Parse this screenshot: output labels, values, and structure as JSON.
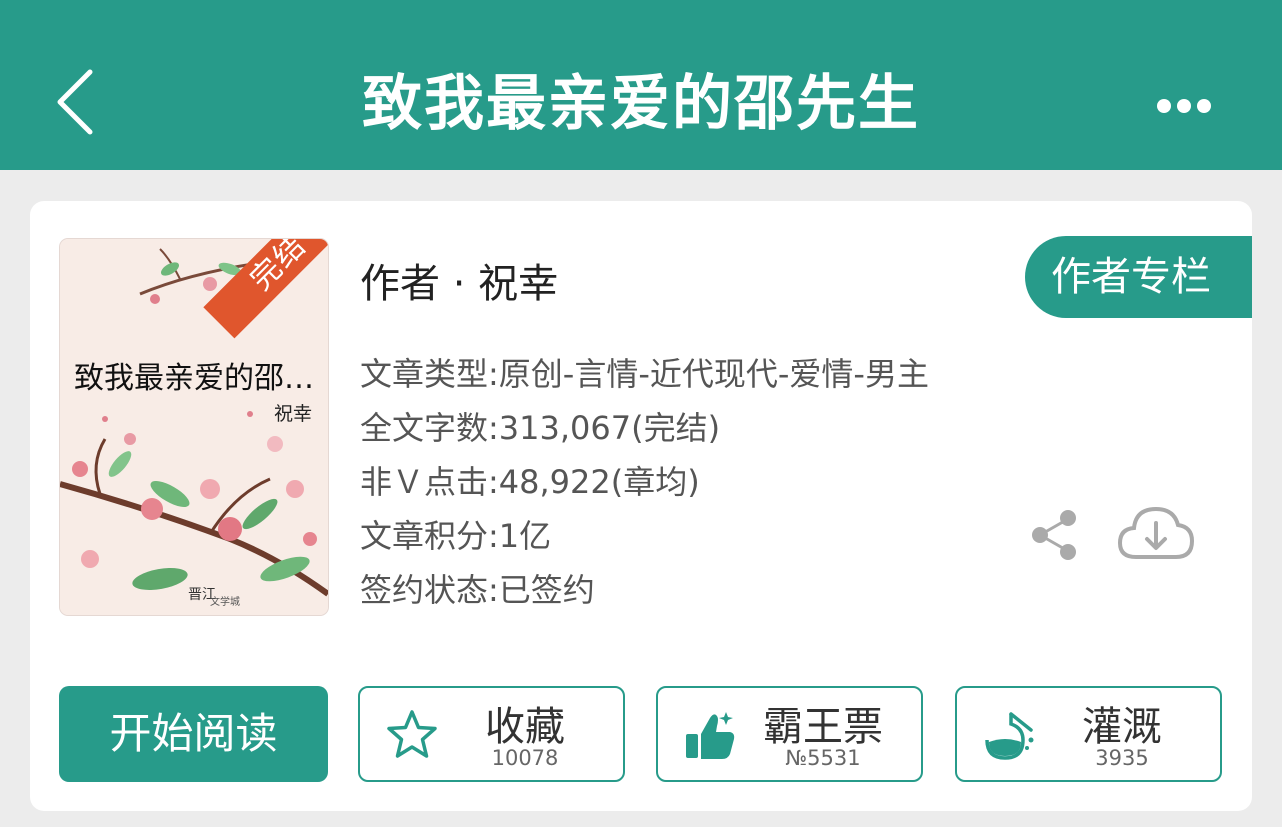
{
  "header": {
    "title": "致我最亲爱的邵先生"
  },
  "book": {
    "cover": {
      "title": "致我最亲爱的邵…",
      "author": "祝幸",
      "status_ribbon": "完结",
      "publisher_logo_text": "晋江文学城"
    },
    "author_line": "作者 · 祝幸",
    "author_column_label": "作者专栏",
    "info": [
      "文章类型:原创-言情-近代现代-爱情-男主",
      "全文字数:313,067(完结)",
      "非Ｖ点击:48,922(章均)",
      "文章积分:1亿",
      "签约状态:已签约"
    ]
  },
  "actions": {
    "read_label": "开始阅读",
    "collect": {
      "label": "收藏",
      "count": "10078"
    },
    "vote": {
      "label": "霸王票",
      "count": "№5531"
    },
    "irrigate": {
      "label": "灌溉",
      "count": "3935"
    }
  },
  "colors": {
    "primary": "#279b8a",
    "ribbon": "#e0562d",
    "background": "#ececec",
    "text_secondary": "#555555"
  },
  "icons": [
    "back-chevron-icon",
    "more-dots-icon",
    "share-icon",
    "cloud-download-icon",
    "star-icon",
    "thumbs-up-icon",
    "flask-icon"
  ]
}
